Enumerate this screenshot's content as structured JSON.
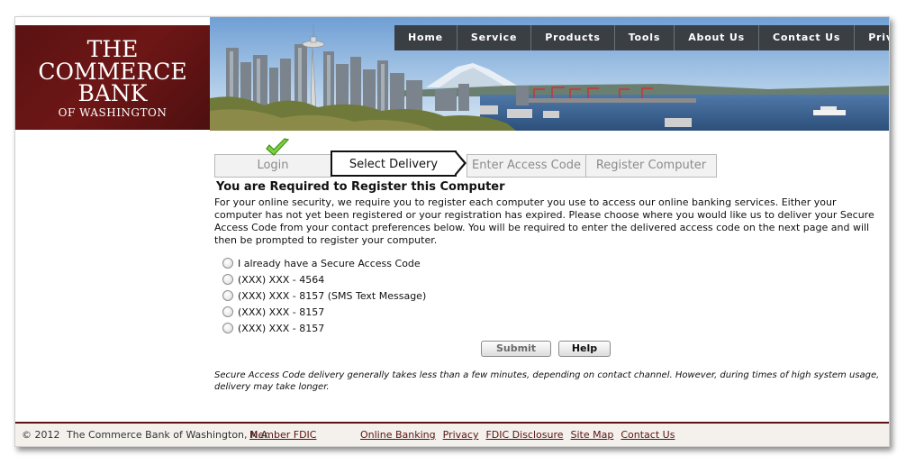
{
  "logo": {
    "line1": "THE",
    "line2": "COMMERCE",
    "line3": "BANK",
    "line4": "OF WASHINGTON",
    "color": "#5a1212"
  },
  "nav": {
    "items": [
      {
        "label": "Home"
      },
      {
        "label": "Service"
      },
      {
        "label": "Products"
      },
      {
        "label": "Tools"
      },
      {
        "label": "About Us"
      },
      {
        "label": "Contact Us"
      },
      {
        "label": "Privacy"
      }
    ]
  },
  "steps": {
    "login": "Login",
    "select": "Select Delivery",
    "enter": "Enter Access Code",
    "register": "Register Computer",
    "completed_icon": "checkmark-icon"
  },
  "main": {
    "title": "You are Required to Register this Computer",
    "intro": "For your online security, we require you to register each computer you use to access our online banking services. Either your computer has not yet been registered or your registration has expired. Please choose where you would like us to deliver your Secure Access Code from your contact preferences below. You will be required to enter the delivered access code on the next page and will then be prompted to register your computer.",
    "options": [
      {
        "label": "I already have a Secure Access Code"
      },
      {
        "label": "(XXX) XXX - 4564"
      },
      {
        "label": "(XXX) XXX - 8157 (SMS Text Message)"
      },
      {
        "label": "(XXX) XXX - 8157"
      },
      {
        "label": "(XXX) XXX - 8157"
      }
    ],
    "submit_label": "Submit",
    "help_label": "Help",
    "note": "Secure Access Code delivery generally takes less than a few minutes, depending on contact channel. However, during times of high system usage, delivery may take longer."
  },
  "footer": {
    "copyright": "© 2012",
    "bank_name": "The Commerce Bank of Washington, N.A.",
    "fdic": "Member FDIC",
    "links": [
      {
        "label": "Online Banking"
      },
      {
        "label": "Privacy"
      },
      {
        "label": "FDIC Disclosure"
      },
      {
        "label": "Site Map"
      },
      {
        "label": "Contact Us"
      }
    ]
  }
}
